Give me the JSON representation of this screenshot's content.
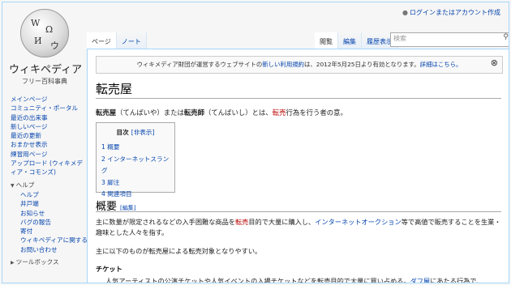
{
  "personal": {
    "login": "ログインまたはアカウント作成"
  },
  "logo": {
    "title": "ウィキペディア",
    "subtitle": "フリー百科事典"
  },
  "tabs": {
    "left": [
      {
        "label": "ページ"
      },
      {
        "label": "ノート"
      }
    ],
    "right": [
      {
        "label": "閲覧"
      },
      {
        "label": "編集"
      },
      {
        "label": "履歴表示"
      }
    ]
  },
  "search": {
    "placeholder": "検索"
  },
  "sidebar": {
    "main": [
      "メインページ",
      "コミュニティ・ポータル",
      "最近の出来事",
      "新しいページ",
      "最近の更新",
      "おまかせ表示",
      "練習用ページ",
      "アップロード (ウィキメディア・コモンズ)"
    ],
    "help_heading": "ヘルプ",
    "help_items": [
      "ヘルプ",
      "井戸端",
      "お知らせ",
      "バグの報告",
      "寄付",
      "ウィキペディアに関するお問い合わせ"
    ],
    "toolbox_heading": "ツールボックス"
  },
  "notice": {
    "pre": "ウィキメディア財団が運営するウェブサイトの",
    "link1": "新しい利用規約",
    "mid": "は、2012年5月25日より有効となります。",
    "link2": "詳細はこちら。"
  },
  "article": {
    "title": "転売屋",
    "lead_b1": "転売屋",
    "lead_t1": "（てんばいや）または",
    "lead_b2": "転売師",
    "lead_t2": "（てんばいし）とは、",
    "lead_link": "転売",
    "lead_t3": "行為を行う者の意。",
    "toc_title": "目次",
    "toc_toggle": "[非表示]",
    "toc_items": [
      "1 概要",
      "2 インターネットスラング",
      "3 脚注",
      "4 関連項目"
    ],
    "section1": "概要",
    "edit_label": "[編集]",
    "p1_a": "主に数量が限定されるなどの入手困難な商品を",
    "p1_link1": "転売",
    "p1_b": "目的で大量に購入し、",
    "p1_link2": "インターネットオークション",
    "p1_c": "等で高値で販売することを生業・趣味とした人々を指す。",
    "p2": "主に以下のものが転売屋による転売対象となりやすい。",
    "sub1": "チケット",
    "p3_a": "人気アーティストの公演チケットや人気イベントの入場チケットなどを転売目的で大量に買い占める。",
    "p3_link": "ダフ屋",
    "p3_b": "にあたる行為で、"
  }
}
